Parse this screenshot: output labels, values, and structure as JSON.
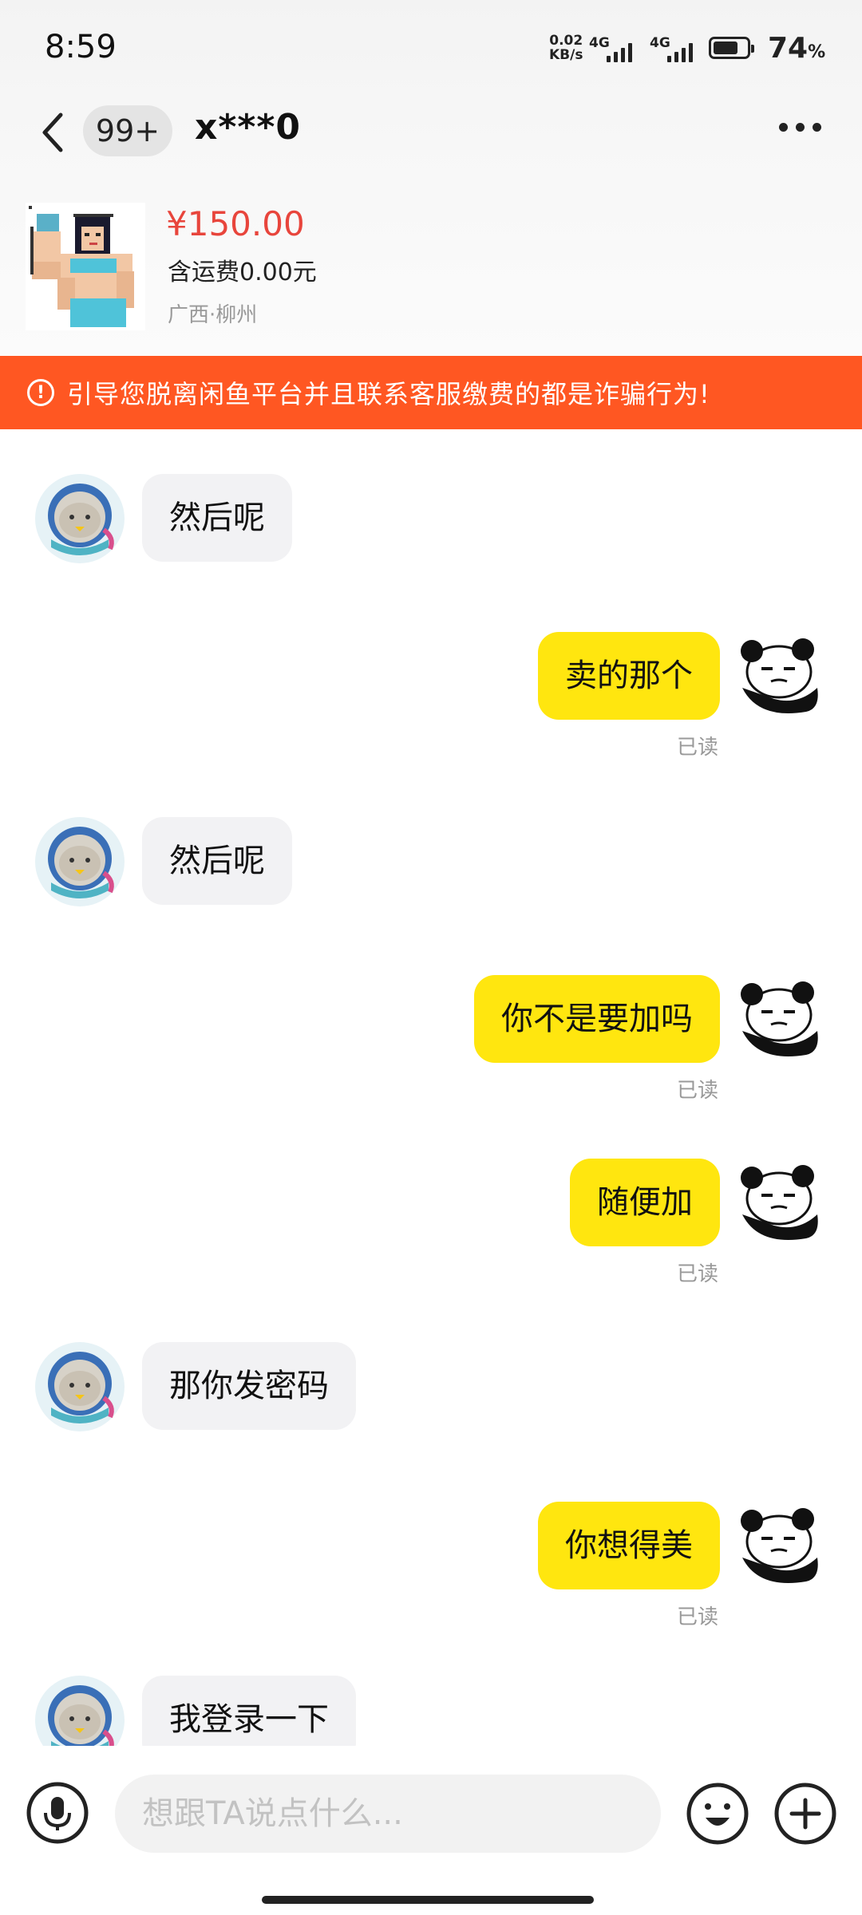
{
  "status_bar": {
    "time": "8:59",
    "net_speed_value": "0.02",
    "net_speed_unit": "KB/s",
    "signal1_label": "4G",
    "signal2_label": "4G",
    "battery_percent": "74",
    "battery_unit": "%",
    "battery_level": 0.74
  },
  "header": {
    "unread_badge": "99+",
    "contact_name": "x***0",
    "back_icon": "chevron-left-icon",
    "more_icon": "more-dots-icon"
  },
  "product": {
    "price": "¥150.00",
    "shipping": "含运费0.00元",
    "location": "广西·柳州"
  },
  "warning": {
    "text": "引导您脱离闲鱼平台并且联系客服缴费的都是诈骗行为!",
    "icon": "exclamation-icon",
    "color": "#ff5722"
  },
  "messages": [
    {
      "from": "other",
      "text": "然后呢"
    },
    {
      "from": "me",
      "text": "卖的那个",
      "status": "已读"
    },
    {
      "from": "other",
      "text": "然后呢"
    },
    {
      "from": "me",
      "text": "你不是要加吗",
      "status": "已读"
    },
    {
      "from": "me",
      "text": "随便加",
      "status": "已读"
    },
    {
      "from": "other",
      "text": "那你发密码"
    },
    {
      "from": "me",
      "text": "你想得美",
      "status": "已读"
    },
    {
      "from": "other",
      "text": "我登录一下"
    }
  ],
  "input_bar": {
    "placeholder": "想跟TA说点什么...",
    "value": "",
    "mic_icon": "microphone-icon",
    "emoji_icon": "emoji-face-icon",
    "plus_icon": "plus-icon"
  },
  "colors": {
    "my_bubble": "#ffe60f",
    "other_bubble": "#f2f2f4",
    "price": "#e8453c"
  }
}
